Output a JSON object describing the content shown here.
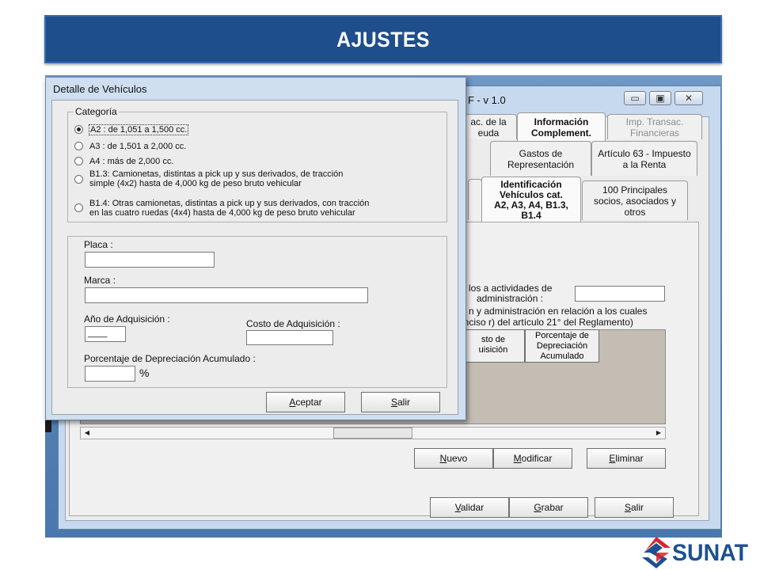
{
  "banner": {
    "title": "AJUSTES"
  },
  "background_window": {
    "title": "F - v 1.0",
    "tabs_row1": [
      {
        "label": "ac. de la\neuda",
        "state": "normal"
      },
      {
        "label": "Información\nComplement.",
        "state": "active"
      },
      {
        "label": "Imp. Transac.\nFinancieras",
        "state": "disabled"
      }
    ],
    "tabs_row2": [
      {
        "label": "Gastos de\nRepresentación"
      },
      {
        "label": "Artículo 63 - Impuesto\na la Renta"
      }
    ],
    "tabs_row3": [
      {
        "label": "Identificación\nVehículos cat.\nA2, A3, A4, B1.3,\nB1.4",
        "state": "active"
      },
      {
        "label": "100 Principales\nsocios, asociados y\notros",
        "state": "normal"
      }
    ],
    "fragments": {
      "line1a": "los a actividades de",
      "line1b": "administración :",
      "line2a": "n y administración en relación a los cuales",
      "line2b": "inciso r) del artículo 21° del Reglamento)"
    },
    "grid_headers": [
      {
        "label": "sto de\nuisición"
      },
      {
        "label": "Porcentaje de\nDepreciación\nAcumulado"
      }
    ],
    "buttons_row1": [
      {
        "label": "Nuevo",
        "underline": "N"
      },
      {
        "label": "Modificar",
        "underline": "M"
      },
      {
        "label": "Eliminar",
        "underline": "E"
      }
    ],
    "buttons_row2": [
      {
        "label": "Validar",
        "underline": "V"
      },
      {
        "label": "Grabar",
        "underline": "G"
      },
      {
        "label": "Salir",
        "underline": "S"
      }
    ],
    "scroll_left": "◀",
    "scroll_right": "▶"
  },
  "dialog": {
    "title": "Detalle de Vehículos",
    "category_group_label": "Categoría",
    "categories": [
      {
        "text": "A2 : de 1,051 a 1,500 cc.",
        "selected": true
      },
      {
        "text": "A3 : de 1,501 a 2,000 cc.",
        "selected": false
      },
      {
        "text": "A4 : más de 2,000 cc.",
        "selected": false
      },
      {
        "text": "B1.3: Camionetas, distintas a pick up y sus derivados, de tracción\nsimple (4x2) hasta de 4,000 kg de peso bruto vehicular",
        "selected": false
      },
      {
        "text": "B1.4:  Otras camionetas, distintas a pick up y  sus derivados, con tracción\nen las cuatro ruedas (4x4) hasta de 4,000 kg de peso bruto vehicular",
        "selected": false
      }
    ],
    "placa_label": "Placa :",
    "placa_value": "",
    "marca_label": "Marca :",
    "marca_value": "",
    "anio_label": "Año de Adquisición :",
    "anio_value": "____",
    "costo_label": "Costo de Adquisición :",
    "costo_value": "",
    "porcentaje_label": "Porcentaje de Depreciación Acumulado :",
    "porcentaje_value": "",
    "percent_sign": "%",
    "buttons": [
      {
        "label": "Aceptar",
        "underline": "A"
      },
      {
        "label": "Salir",
        "underline": "S"
      }
    ]
  },
  "logo": {
    "text": "SUNAT",
    "colors": {
      "red": "#d7262b",
      "blue": "#1d4f91"
    }
  }
}
